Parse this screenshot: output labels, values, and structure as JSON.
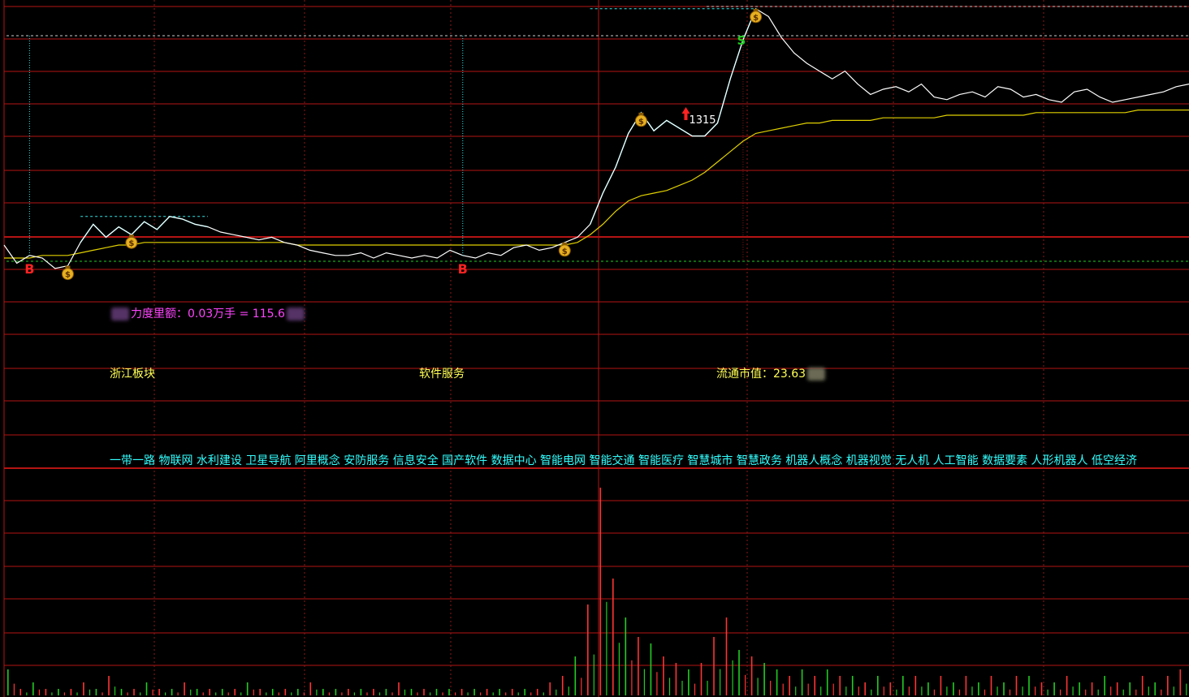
{
  "colors": {
    "background": "#000000",
    "grid_red": "#b41414",
    "grid_dotted": "#8a1a1a",
    "price_line": "#ffffff",
    "surge_line": "#33e6e6",
    "avg_line": "#e0d000",
    "vol_up": "#ff3333",
    "vol_down": "#22cc22",
    "buy_marker": "#ff2222",
    "sell_marker": "#22cc22",
    "money_bag": "#e8b020",
    "text_magenta": "#ff44ff",
    "text_yellow": "#ffff55",
    "text_cyan": "#33ffff"
  },
  "icons": {
    "buy_signal": "B",
    "sell_signal": "S",
    "money_bag_icon": "money-bag",
    "up_arrow_icon": "red-arrow-up"
  },
  "annotations": {
    "arrow_label": "1315"
  },
  "info": {
    "force_prefix": "",
    "force_text": "力度里额：0.03万手 = 115.6",
    "sector": "浙江板块",
    "industry": "软件服务",
    "float_cap_label": "流通市值：23.63",
    "concepts": "一带一路 物联网 水利建设 卫星导航 阿里概念 安防服务 信息安全 国产软件 数据中心 智能电网 智能交通 智能医疗 智慧城市 智慧政务 机器人概念 机器视觉 无人机 人工智能 数据要素 人形机器人 低空经济"
  },
  "chart_data": {
    "type": "line",
    "series": [
      {
        "values": [
          0.5,
          -0.2,
          0.1,
          0.0,
          -0.4,
          -0.3,
          0.6,
          1.3,
          0.8,
          1.2,
          0.9,
          1.4,
          1.1,
          1.6,
          1.5,
          1.3,
          1.2,
          1.0,
          0.9,
          0.8,
          0.7,
          0.8,
          0.6,
          0.5,
          0.3,
          0.2,
          0.1,
          0.1,
          0.2,
          0.0,
          0.2,
          0.1,
          0.0,
          0.1,
          0.0,
          0.3,
          0.1,
          0.0,
          0.2,
          0.1,
          0.4,
          0.5,
          0.3,
          0.4,
          0.6,
          0.8,
          1.3,
          2.5,
          3.5,
          4.8,
          5.6,
          4.9,
          5.3,
          5.0,
          4.7,
          4.7,
          5.2,
          6.9,
          8.4,
          9.6,
          9.3,
          8.5,
          7.9,
          7.5,
          7.2,
          6.9,
          7.2,
          6.7,
          6.3,
          6.5,
          6.6,
          6.4,
          6.7,
          6.2,
          6.1,
          6.3,
          6.4,
          6.2,
          6.6,
          6.5,
          6.2,
          6.3,
          6.1,
          6.0,
          6.4,
          6.5,
          6.2,
          6.0,
          6.1,
          6.2,
          6.3,
          6.4,
          6.6,
          6.7
        ]
      },
      {
        "values": [
          0.0,
          0.0,
          0.0,
          0.1,
          0.1,
          0.1,
          0.2,
          0.3,
          0.4,
          0.5,
          0.5,
          0.6,
          0.6,
          0.6,
          0.6,
          0.6,
          0.6,
          0.6,
          0.6,
          0.6,
          0.6,
          0.6,
          0.6,
          0.5,
          0.5,
          0.5,
          0.5,
          0.5,
          0.5,
          0.5,
          0.5,
          0.5,
          0.5,
          0.5,
          0.5,
          0.5,
          0.5,
          0.5,
          0.5,
          0.5,
          0.5,
          0.5,
          0.5,
          0.5,
          0.5,
          0.6,
          0.9,
          1.3,
          1.8,
          2.2,
          2.4,
          2.5,
          2.6,
          2.8,
          3.0,
          3.3,
          3.7,
          4.1,
          4.5,
          4.8,
          4.9,
          5.0,
          5.1,
          5.2,
          5.2,
          5.3,
          5.3,
          5.3,
          5.3,
          5.4,
          5.4,
          5.4,
          5.4,
          5.4,
          5.5,
          5.5,
          5.5,
          5.5,
          5.5,
          5.5,
          5.5,
          5.6,
          5.6,
          5.6,
          5.6,
          5.6,
          5.6,
          5.6,
          5.6,
          5.7,
          5.7,
          5.7,
          5.7,
          5.7
        ]
      }
    ],
    "surge_segments": [
      [
        6,
        16
      ],
      [
        46,
        59
      ]
    ],
    "buy_signals": [
      2,
      36
    ],
    "sell_signals": [
      58
    ],
    "money_bags": [
      5,
      10,
      44,
      50,
      59
    ],
    "arrow_index": 53,
    "volume": [
      4,
      1,
      2,
      1,
      1,
      1,
      2,
      1,
      3,
      1,
      1,
      2,
      1,
      1,
      2,
      1,
      1,
      1,
      1,
      2,
      1,
      1,
      1,
      1,
      2,
      1,
      1,
      1,
      1,
      1,
      1,
      2,
      1,
      1,
      1,
      1,
      1,
      1,
      1,
      1,
      1,
      1,
      1,
      2,
      3,
      6,
      14,
      32,
      18,
      12,
      9,
      8,
      6,
      5,
      4,
      5,
      9,
      12,
      7,
      6,
      5,
      4,
      3,
      4,
      3,
      4,
      3,
      3,
      2,
      3,
      2,
      3,
      3,
      2,
      3,
      2,
      3,
      2,
      3,
      2,
      3,
      3,
      2,
      2,
      3,
      2,
      2,
      3,
      2,
      2,
      3,
      2,
      3,
      4
    ],
    "volume_up": [
      false,
      true,
      false,
      true,
      false,
      true,
      true,
      false,
      true,
      false,
      true,
      false,
      true,
      false,
      true,
      false,
      true,
      false,
      true,
      false,
      true,
      false,
      true,
      false,
      true,
      false,
      false,
      true,
      false,
      true,
      false,
      true,
      false,
      true,
      false,
      false,
      true,
      false,
      true,
      false,
      true,
      false,
      true,
      true,
      true,
      false,
      true,
      true,
      true,
      false,
      true,
      false,
      true,
      true,
      false,
      true,
      true,
      true,
      false,
      true,
      false,
      false,
      true,
      false,
      true,
      false,
      true,
      false,
      true,
      false,
      true,
      false,
      true,
      false,
      true,
      false,
      true,
      false,
      true,
      false,
      true,
      false,
      true,
      false,
      true,
      false,
      true,
      false,
      true,
      false,
      true,
      false,
      true,
      true
    ]
  }
}
